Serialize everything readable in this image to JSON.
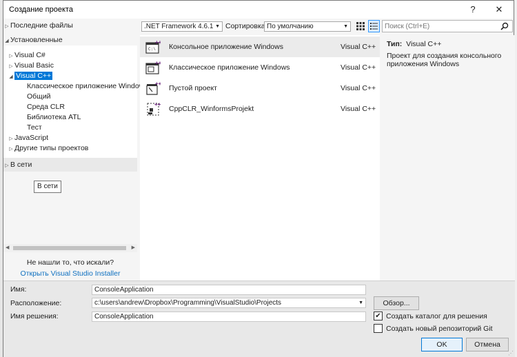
{
  "window": {
    "title": "Создание проекта",
    "help": "?",
    "close": "✕"
  },
  "left": {
    "recent": "Последние файлы",
    "installed": "Установленные",
    "tree": [
      {
        "label": "Visual C#",
        "arrow": "▷"
      },
      {
        "label": "Visual Basic",
        "arrow": "▷"
      },
      {
        "label": "Visual C++",
        "arrow": "◢"
      },
      {
        "label": "Классическое приложение Window",
        "arrow": ""
      },
      {
        "label": "Общий",
        "arrow": ""
      },
      {
        "label": "Среда CLR",
        "arrow": ""
      },
      {
        "label": "Библиотека ATL",
        "arrow": ""
      },
      {
        "label": "Тест",
        "arrow": ""
      },
      {
        "label": "JavaScript",
        "arrow": "▷"
      },
      {
        "label": "Другие типы проектов",
        "arrow": "▷"
      }
    ],
    "online": "В сети",
    "tooltip": "В сети",
    "not_found": "Не нашли то, что искали?",
    "installer_link": "Открыть Visual Studio Installer"
  },
  "toolbar": {
    "framework": ".NET Framework 4.6.1",
    "sort_label": "Сортировка:",
    "sort_value": "По умолчанию",
    "search_placeholder": "Поиск (Ctrl+E)"
  },
  "templates": [
    {
      "name": "Консольное приложение Windows",
      "lang": "Visual C++",
      "icon": "console-app-icon"
    },
    {
      "name": "Классическое приложение Windows",
      "lang": "Visual C++",
      "icon": "desktop-app-icon"
    },
    {
      "name": "Пустой проект",
      "lang": "Visual C++",
      "icon": "empty-project-icon"
    },
    {
      "name": "CppCLR_WinformsProjekt",
      "lang": "Visual C++",
      "icon": "winforms-icon"
    }
  ],
  "details": {
    "type_label": "Тип:",
    "type_value": "Visual C++",
    "description": "Проект для создания консольного приложения Windows"
  },
  "form": {
    "name_label": "Имя:",
    "name_value": "ConsoleApplication",
    "location_label": "Расположение:",
    "location_value": "c:\\users\\andrew\\Dropbox\\Programming\\VisualStudio\\Projects",
    "solution_label": "Имя решения:",
    "solution_value": "ConsoleApplication",
    "browse": "Обзор...",
    "create_dir": "Создать каталог для решения",
    "create_dir_checked": "✔",
    "create_git": "Создать новый репозиторий Git",
    "ok": "OK",
    "cancel": "Отмена"
  },
  "colors": {
    "accent": "#0078d7",
    "link": "#0e70c0",
    "vs_purple": "#68217a"
  }
}
